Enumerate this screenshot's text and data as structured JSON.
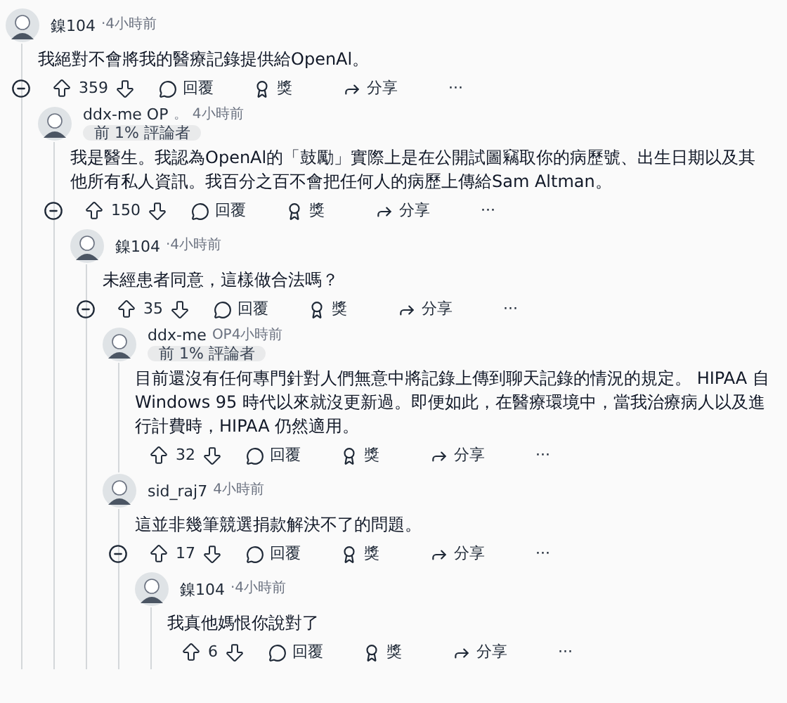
{
  "comments": [
    {
      "author": "鎳104",
      "time": "‧4小時前",
      "body": "我絕對不會將我的醫療記錄提供給OpenAl。",
      "collapsible": true,
      "actions": {
        "score": "359",
        "reply": "回覆",
        "award": "獎",
        "share": "分享",
        "more": "···"
      },
      "children": [
        {
          "author": "ddx-me OP",
          "time": "。 4小時前",
          "flair": "前 1% 評論者",
          "body": "我是醫生。我認為OpenAl的「鼓勵」實際上是在公開試圖竊取你的病歷號、出生日期以及其他所有私人資訊。我百分之百不會把任何人的病歷上傳給Sam Altman。",
          "collapsible": true,
          "actions": {
            "score": "150",
            "reply": "回覆",
            "award": "獎",
            "share": "分享",
            "more": "···"
          },
          "children": [
            {
              "author": "鎳104",
              "time": "‧4小時前",
              "body": "未經患者同意，這樣做合法嗎？",
              "collapsible": true,
              "actions": {
                "score": "35",
                "reply": "回覆",
                "award": "獎",
                "share": "分享",
                "more": "···"
              },
              "children": [
                {
                  "author": "ddx-me",
                  "time": "OP4小時前",
                  "flair": "前 1% 評論者",
                  "body": "目前還沒有任何專門針對人們無意中將記錄上傳到聊天記錄的情況的規定。 HIPAA 自 Windows 95 時代以來就沒更新過。即便如此，在醫療環境中，當我治療病人以及進行計費時，HIPAA 仍然適用。",
                  "collapsible": false,
                  "actions": {
                    "score": "32",
                    "reply": "回覆",
                    "award": "獎",
                    "share": "分享",
                    "more": "···"
                  }
                },
                {
                  "author": "sid_raj7",
                  "time": "4小時前",
                  "body": "這並非幾筆競選捐款解決不了的問題。",
                  "collapsible": true,
                  "actions": {
                    "score": "17",
                    "reply": "回覆",
                    "award": "獎",
                    "share": "分享",
                    "more": "···"
                  },
                  "children": [
                    {
                      "author": "鎳104",
                      "time": "‧4小時前",
                      "body": "我真他媽恨你說對了",
                      "collapsible": false,
                      "actions": {
                        "score": "6",
                        "reply": "回覆",
                        "award": "獎",
                        "share": "分享",
                        "more": "···"
                      }
                    }
                  ]
                }
              ]
            }
          ]
        }
      ]
    }
  ]
}
